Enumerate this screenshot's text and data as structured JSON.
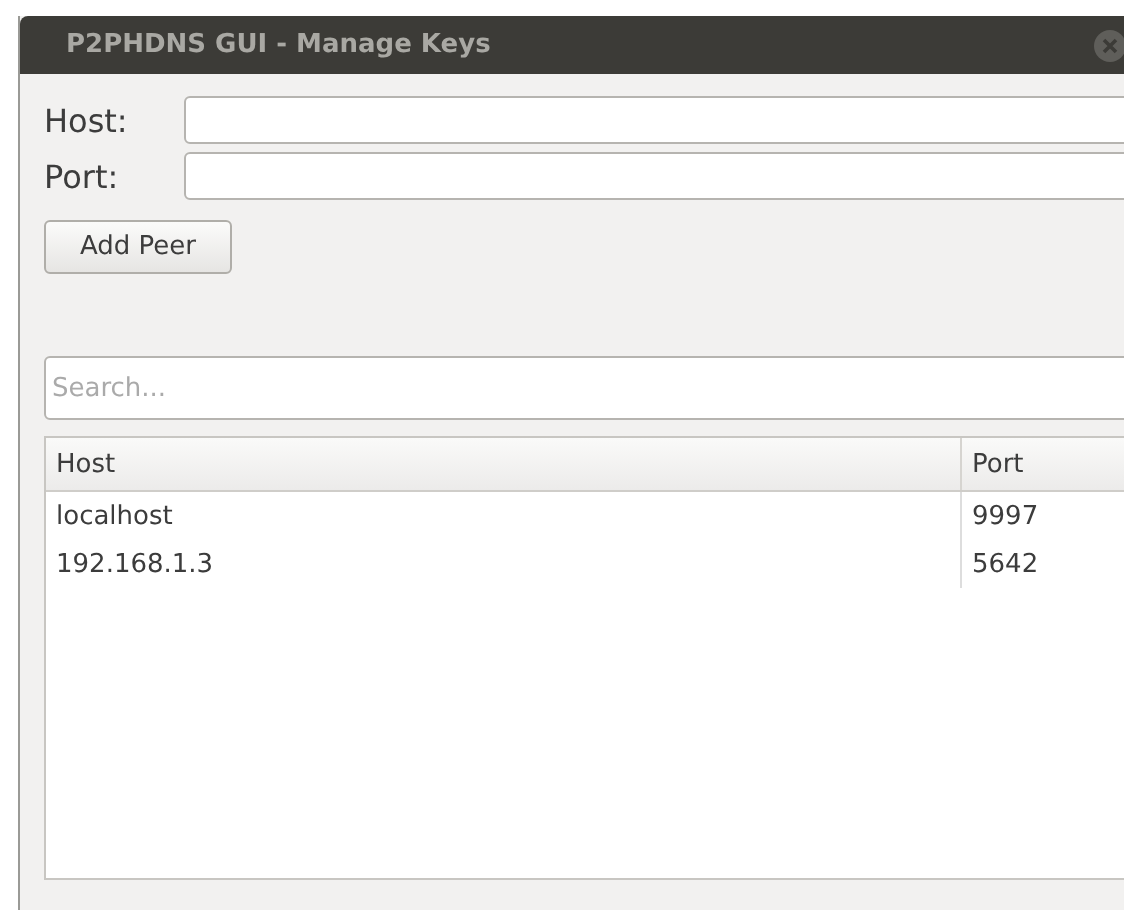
{
  "window": {
    "title": "P2PHDNS GUI - Manage Keys"
  },
  "form": {
    "fields": [
      {
        "label": "Host:"
      },
      {
        "label": "Port:"
      }
    ],
    "button": "Add Peer"
  },
  "search": {
    "placeholder": "Search..."
  },
  "table": {
    "columns": [
      "Host",
      "Port"
    ],
    "rows": [
      [
        "localhost",
        "9997"
      ],
      [
        "192.168.1.3",
        "5642"
      ]
    ]
  }
}
